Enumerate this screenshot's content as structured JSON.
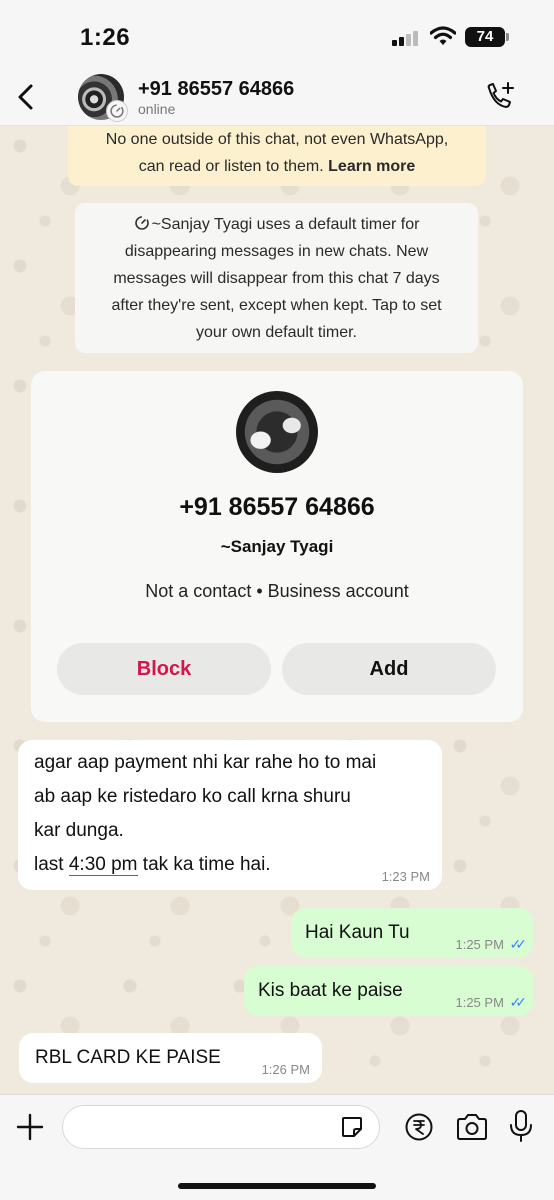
{
  "status_bar": {
    "time": "1:26",
    "battery": "74"
  },
  "header": {
    "contact_number": "+91 86557 64866",
    "contact_status": "online"
  },
  "encryption_notice": {
    "line1": "No one outside of this chat, not even WhatsApp,",
    "line2": "can read or listen to them.",
    "learn_more": "Learn more"
  },
  "timer_notice": {
    "lines": [
      "~Sanjay Tyagi uses a default timer for",
      "disappearing messages in new chats. New",
      "messages will disappear from this chat 7 days",
      "after they're sent, except when kept. Tap to set",
      "your own default timer."
    ]
  },
  "profile_card": {
    "number": "+91 86557 64866",
    "name": "~Sanjay Tyagi",
    "type": "Not a contact • Business account",
    "block_label": "Block",
    "add_label": "Add"
  },
  "messages": [
    {
      "direction": "incoming",
      "lines": [
        "agar aap payment nhi kar rahe ho to mai",
        "ab aap ke ristedaro ko call krna shuru",
        "kar dunga."
      ],
      "last_line_prefix": "last ",
      "last_line_time": "4:30 pm",
      "last_line_suffix": " tak ka time hai.",
      "time": "1:23 PM"
    },
    {
      "direction": "outgoing",
      "text": "Hai Kaun Tu",
      "time": "1:25 PM",
      "read": true
    },
    {
      "direction": "outgoing",
      "text": "Kis baat ke paise",
      "time": "1:25 PM",
      "read": true
    },
    {
      "direction": "incoming",
      "text": "RBL CARD KE PAISE",
      "time": "1:26 PM"
    }
  ],
  "input_bar": {
    "placeholder": ""
  },
  "colors": {
    "block_red": "#d1174b",
    "outgoing_bubble": "#d8fdd2",
    "notice_yellow": "#fcf0cf",
    "read_tick_blue": "#3b82f6"
  }
}
